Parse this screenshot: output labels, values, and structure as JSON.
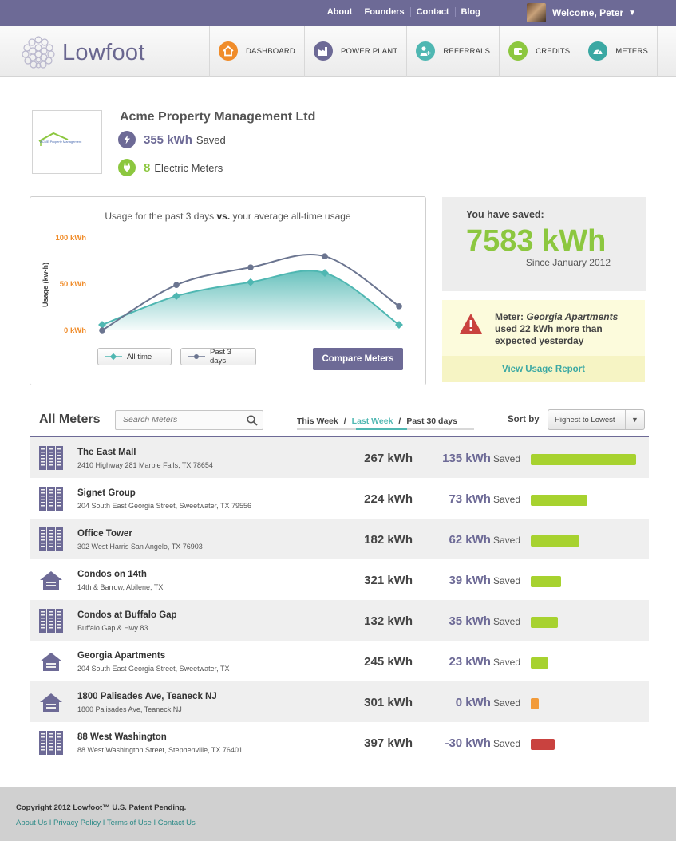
{
  "topbar": {
    "links": [
      "About",
      "Founders",
      "Contact",
      "Blog"
    ],
    "welcome": "Welcome, Peter"
  },
  "brand": {
    "name": "Lowfoot"
  },
  "nav": [
    {
      "label": "DASHBOARD",
      "icon": "home-icon",
      "color": "#f08c2a"
    },
    {
      "label": "POWER PLANT",
      "icon": "factory-icon",
      "color": "#6d6a96"
    },
    {
      "label": "REFERRALS",
      "icon": "user-add-icon",
      "color": "#4fb7b2"
    },
    {
      "label": "CREDITS",
      "icon": "wallet-icon",
      "color": "#8cc73f"
    },
    {
      "label": "METERS",
      "icon": "gauge-icon",
      "color": "#3ba8a3"
    }
  ],
  "company": {
    "name": "Acme Property Management Ltd",
    "logo_text": "ACME Property Management",
    "saved_value": "355 kWh",
    "saved_label": "Saved",
    "meters_value": "8",
    "meters_label": "Electric Meters"
  },
  "chart_data": {
    "type": "line",
    "title_prefix": "Usage for the past 3 days",
    "title_vs": "vs.",
    "title_suffix": "your average all-time usage",
    "ylabel": "Usage (kw-h)",
    "y_tick_labels": [
      "100 kWh",
      "50 kWh",
      "0 kWh"
    ],
    "y_ticks": [
      100,
      50,
      0
    ],
    "ylim": [
      0,
      100
    ],
    "x": [
      0,
      1,
      2,
      3,
      4
    ],
    "series": [
      {
        "name": "All time",
        "values": [
          6,
          37,
          52,
          62,
          6
        ],
        "style": "area",
        "color": "#4fb7b2"
      },
      {
        "name": "Past 3 days",
        "values": [
          0,
          49,
          68,
          80,
          26
        ],
        "style": "line",
        "color": "#6b7590"
      }
    ],
    "legend": "bottom-left",
    "grid": false
  },
  "chart": {
    "compare_button": "Compare Meters"
  },
  "saved_card": {
    "label": "You have saved:",
    "value": "7583 kWh",
    "since": "Since January 2012",
    "color": "#8cc73f"
  },
  "alert": {
    "prefix": "Meter:",
    "meter": "Georgia Apartments",
    "message": "used 22 kWh more than expected yesterday",
    "link": "View Usage Report"
  },
  "meters": {
    "title": "All Meters",
    "search_placeholder": "Search Meters",
    "periods": [
      "This Week",
      "Last Week",
      "Past 30 days"
    ],
    "period_separator": "/",
    "active_period": "Last Week",
    "sort_label": "Sort by",
    "sort_value": "Highest to Lowest",
    "saved_suffix": "Saved",
    "rows": [
      {
        "name": "The East Mall",
        "address": "2410 Highway 281 Marble Falls, TX 78654",
        "usage": "267 kWh",
        "saved": "135 kWh",
        "saved_value": 135,
        "building": "office",
        "bar_color": "#a7d22f"
      },
      {
        "name": "Signet Group",
        "address": "204 South East Georgia Street, Sweetwater, TX 79556",
        "usage": "224 kWh",
        "saved": "73 kWh",
        "saved_value": 73,
        "building": "office",
        "bar_color": "#a7d22f"
      },
      {
        "name": "Office Tower",
        "address": "302 West Harris San Angelo, TX 76903",
        "usage": "182 kWh",
        "saved": "62 kWh",
        "saved_value": 62,
        "building": "office",
        "bar_color": "#a7d22f"
      },
      {
        "name": "Condos on 14th",
        "address": "14th & Barrow, Abilene, TX",
        "usage": "321 kWh",
        "saved": "39 kWh",
        "saved_value": 39,
        "building": "house",
        "bar_color": "#a7d22f"
      },
      {
        "name": "Condos at Buffalo Gap",
        "address": "Buffalo Gap & Hwy 83",
        "usage": "132 kWh",
        "saved": "35 kWh",
        "saved_value": 35,
        "building": "office",
        "bar_color": "#a7d22f"
      },
      {
        "name": "Georgia Apartments",
        "address": "204 South East Georgia Street, Sweetwater, TX",
        "usage": "245 kWh",
        "saved": "23 kWh",
        "saved_value": 23,
        "building": "house",
        "bar_color": "#a7d22f"
      },
      {
        "name": "1800 Palisades Ave, Teaneck NJ",
        "address": "1800 Palisades Ave, Teaneck NJ",
        "usage": "301 kWh",
        "saved": "0 kWh",
        "saved_value": 0,
        "building": "house",
        "bar_color": "#f29b3a"
      },
      {
        "name": "88 West Washington",
        "address": "88 West Washington Street, Stephenville, TX 76401",
        "usage": "397 kWh",
        "saved": "-30 kWh",
        "saved_value": -30,
        "building": "office",
        "bar_color": "#c9423f"
      }
    ]
  },
  "footer": {
    "copyright": "Copyright 2012 Lowfoot™ U.S. Patent Pending.",
    "links": [
      "About Us",
      "Privacy Policy",
      "Terms of Use",
      "Contact Us"
    ],
    "separator": "I"
  }
}
